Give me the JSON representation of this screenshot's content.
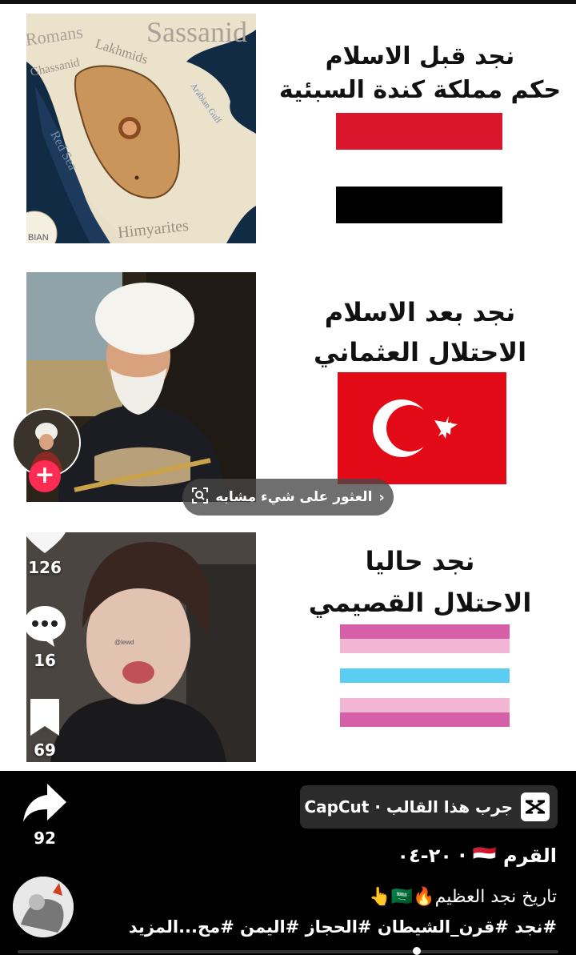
{
  "panels": [
    {
      "title_line1": "نجد قبل الاسلام",
      "title_line2": "حكم مملكة كندة السبئية",
      "map_labels": {
        "top": "Sassanid",
        "left_top": "Romans",
        "ghassanid": "Ghassanid",
        "lakhmids": "Lakhmids",
        "gulf": "Arabian Gulf",
        "sea": "Red Sea",
        "bottom": "Himyarites",
        "logo": "BIAN"
      }
    },
    {
      "title_line1": "نجد بعد الاسلام",
      "title_line2": "الاحتلال العثماني"
    },
    {
      "title_line1": "نجد حاليا",
      "title_line2": "الاحتلال القصيمي",
      "watermark": "@lewd"
    }
  ],
  "colors": {
    "yemen_red": "#d9162b",
    "yemen_black": "#000000",
    "turkey_red": "#e30a17",
    "pink": "#d660a8",
    "light_pink": "#f2b5d4",
    "blue": "#5bcdf2",
    "capcut_bg": "#2b2b2b"
  },
  "lens": {
    "label": "العثور على شيء مشابه",
    "icon": "lens-scan-icon"
  },
  "actions": {
    "likes": "126",
    "comments": "16",
    "saves": "69",
    "shares": "92"
  },
  "capcut": {
    "label": "CapCut · جرب هذا القالب"
  },
  "author": {
    "name": "القرم 🇾🇪 · ٢٠-٠٤"
  },
  "description": {
    "line1": "تاريخ نجد العظيم🔥🇸🇦👆",
    "line2": "#نجد #قرن_الشيطان #الحجاز #اليمن #مح...المزيد"
  }
}
